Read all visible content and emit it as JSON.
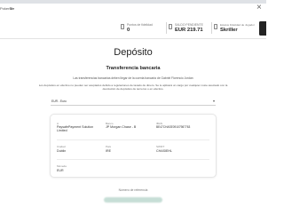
{
  "window": {
    "close_glyph": "×"
  },
  "brand": {
    "prefix": "Poker",
    "name": "Str"
  },
  "stats": [
    {
      "label": "Puntos de fidelidad",
      "value": "0"
    },
    {
      "label": "SALDO PENDIENTE",
      "value": "EUR 219.71"
    },
    {
      "label": "Estatus Fidelidad de Jugador",
      "value": "Skriller"
    }
  ],
  "main": {
    "title": "Depósito",
    "section_title": "Transferencia bancaria",
    "info_line1": "Las transferencias bancarias deben llegar de la cuenta bancaria de Gabriel Florencio Jordán",
    "info_line2": "Los depósitos en efectivo no pueden ser aceptados debido a regulaciones de lavado de dinero. Se le aplicará un cargo por cualquier coste asociado con la devolución de depósitos de terceros o en efectivo.",
    "currency_select": "EUR - Euro",
    "caret": "▾"
  },
  "bank_details": {
    "payee": {
      "label": "A",
      "value": "PaysafePayment Solution Limited"
    },
    "bank": {
      "label": "Banco",
      "value": "JP Morgan Chase - B"
    },
    "iban": {
      "label": "IBAN",
      "value": "BE47CHASE09107987763"
    },
    "city": {
      "label": "Ciudad",
      "value": "Dublin"
    },
    "country": {
      "label": "País",
      "value": "IRE"
    },
    "swift": {
      "label": "SWIFT",
      "value": "CHASIEHL"
    },
    "currency": {
      "label": "Moneda",
      "value": "EUR"
    }
  },
  "reference": {
    "label": "Número de referencia"
  },
  "colors": {
    "accent_dark": "#232323",
    "reference_blur": "#c6ded6"
  },
  "icons": [
    "close-icon",
    "loyalty-icon",
    "wallet-icon",
    "status-icon",
    "caret-down-icon"
  ]
}
